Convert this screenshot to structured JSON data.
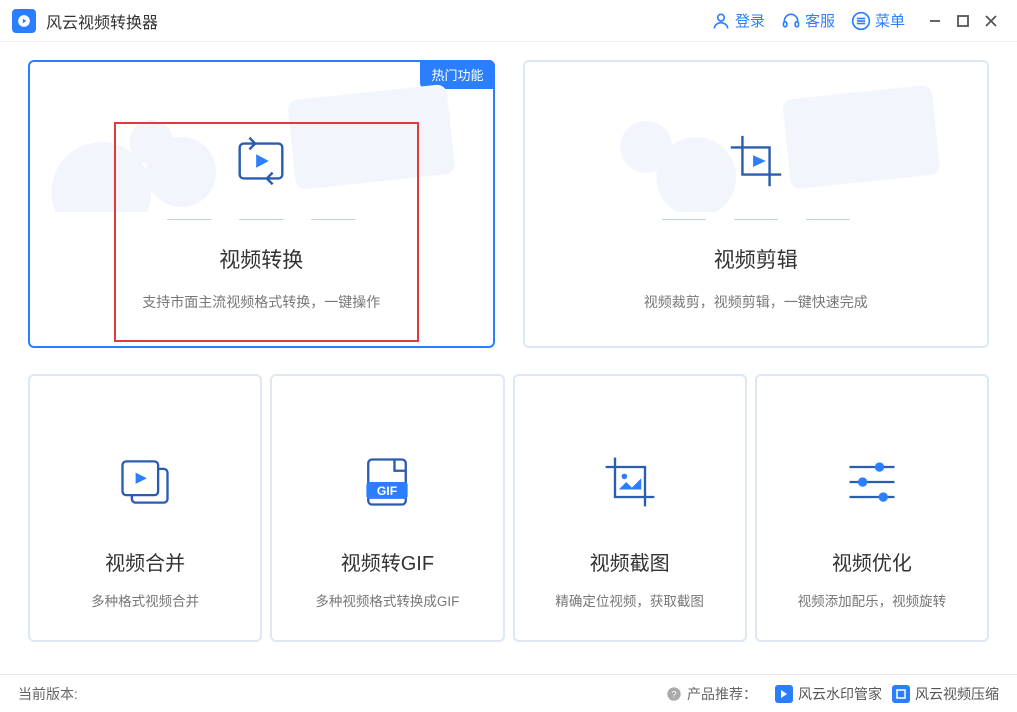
{
  "app": {
    "title": "风云视频转换器"
  },
  "titlebar": {
    "login": "登录",
    "service": "客服",
    "menu": "菜单"
  },
  "top_cards": [
    {
      "title": "视频转换",
      "desc": "支持市面主流视频格式转换，一键操作",
      "badge": "热门功能"
    },
    {
      "title": "视频剪辑",
      "desc": "视频裁剪，视频剪辑，一键快速完成"
    }
  ],
  "bottom_cards": [
    {
      "title": "视频合并",
      "desc": "多种格式视频合并"
    },
    {
      "title": "视频转GIF",
      "desc": "多种视频格式转换成GIF",
      "gif_label": "GIF"
    },
    {
      "title": "视频截图",
      "desc": "精确定位视频，获取截图"
    },
    {
      "title": "视频优化",
      "desc": "视频添加配乐，视频旋转"
    }
  ],
  "status": {
    "version_label": "当前版本:",
    "recommend_label": "产品推荐：",
    "rec1": "风云水印管家",
    "rec2": "风云视频压缩"
  }
}
